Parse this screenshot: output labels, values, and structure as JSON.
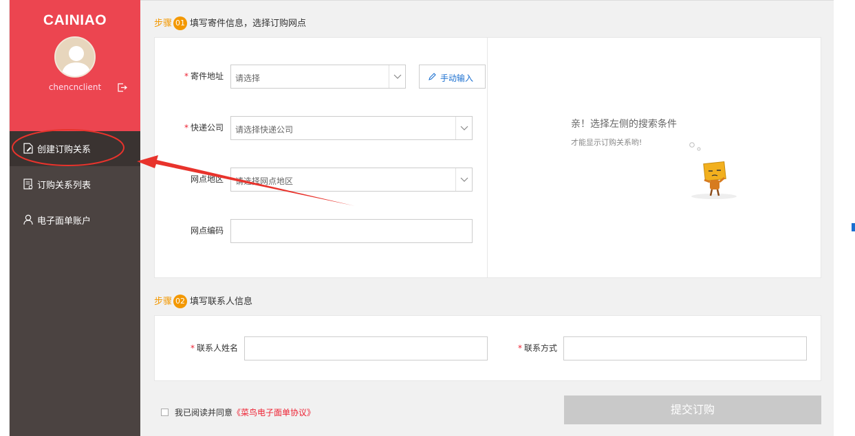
{
  "brand": "CAINIAO",
  "user": {
    "name": "chencnclient"
  },
  "sidebar": {
    "items": [
      {
        "label": "创建订购关系",
        "icon": "edit-doc-icon"
      },
      {
        "label": "订购关系列表",
        "icon": "list-doc-icon"
      },
      {
        "label": "电子面单账户",
        "icon": "user-icon"
      }
    ]
  },
  "step1": {
    "prefix": "步骤",
    "num": "01",
    "title": "填写寄件信息，选择订购网点",
    "fields": {
      "address_label": "寄件地址",
      "address_placeholder": "请选择",
      "manual_label": "手动输入",
      "company_label": "快递公司",
      "company_placeholder": "请选择快递公司",
      "region_label": "网点地区",
      "region_placeholder": "请选择网点地区",
      "code_label": "网点编码",
      "required_mark": "*"
    },
    "empty": {
      "title": "亲！选择左侧的搜索条件",
      "subtitle": "才能显示订购关系哟!"
    }
  },
  "step2": {
    "prefix": "步骤",
    "num": "02",
    "title": "填写联系人信息",
    "name_label": "联系人姓名",
    "contact_label": "联系方式"
  },
  "agreement": {
    "text": "我已阅读并同意",
    "link": "《菜鸟电子面单协议》"
  },
  "submit_label": "提交订购",
  "colors": {
    "sidebar_header": "#ec4550",
    "sidebar": "#4b4341",
    "accent": "#f39800",
    "annotation": "#e8332c"
  }
}
